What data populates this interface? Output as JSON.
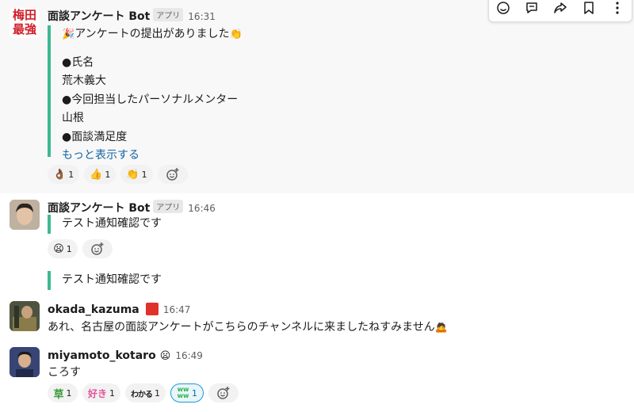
{
  "messages": [
    {
      "author": "面談アンケート Bot",
      "badge": "アプリ",
      "time": "16:31",
      "avatar_text": "梅田最強",
      "intro": "アンケートの提出がありました",
      "lines": [
        "●氏名",
        "荒木義大",
        "●今回担当したパーソナルメンター",
        "山根",
        "●面談満足度"
      ],
      "show_more": "もっと表示する",
      "reactions": [
        {
          "icon": "ok-hand-icon",
          "emoji": "👌🏾",
          "count": "1"
        },
        {
          "icon": "thumbs-up-icon",
          "emoji": "👍",
          "count": "1"
        },
        {
          "icon": "clapping-icon",
          "emoji": "👏",
          "count": "1"
        }
      ]
    },
    {
      "author": "面談アンケート Bot",
      "badge": "アプリ",
      "time": "16:46",
      "text": "テスト通知確認です",
      "reactions": [
        {
          "icon": "face-icon",
          "emoji": "😦",
          "count": "1"
        }
      ],
      "followup": "テスト通知確認です"
    },
    {
      "author": "okada_kazuma",
      "status_emoji": "custom-status-icon",
      "time": "16:47",
      "text": "あれ、名古屋の面談アンケートがこちらのチャンネルに来ましたねすみません",
      "trailing_emoji": "🙇"
    },
    {
      "author": "miyamoto_kotaro",
      "status_emoji": "face-icon",
      "time": "16:49",
      "text": "ころす",
      "reactions": [
        {
          "icon": "kusa-icon",
          "label": "草",
          "count": "1"
        },
        {
          "icon": "suki-icon",
          "label": "好き",
          "count": "1"
        },
        {
          "icon": "wakaru-icon",
          "label": "わかる",
          "count": "1"
        },
        {
          "icon": "www-icon",
          "label": "ww ww",
          "count": "1",
          "active": true
        }
      ]
    }
  ],
  "colors": {
    "quote_bar": "#3eb991",
    "link": "#1264a3",
    "highlight_bg": "#f8f8f8"
  }
}
